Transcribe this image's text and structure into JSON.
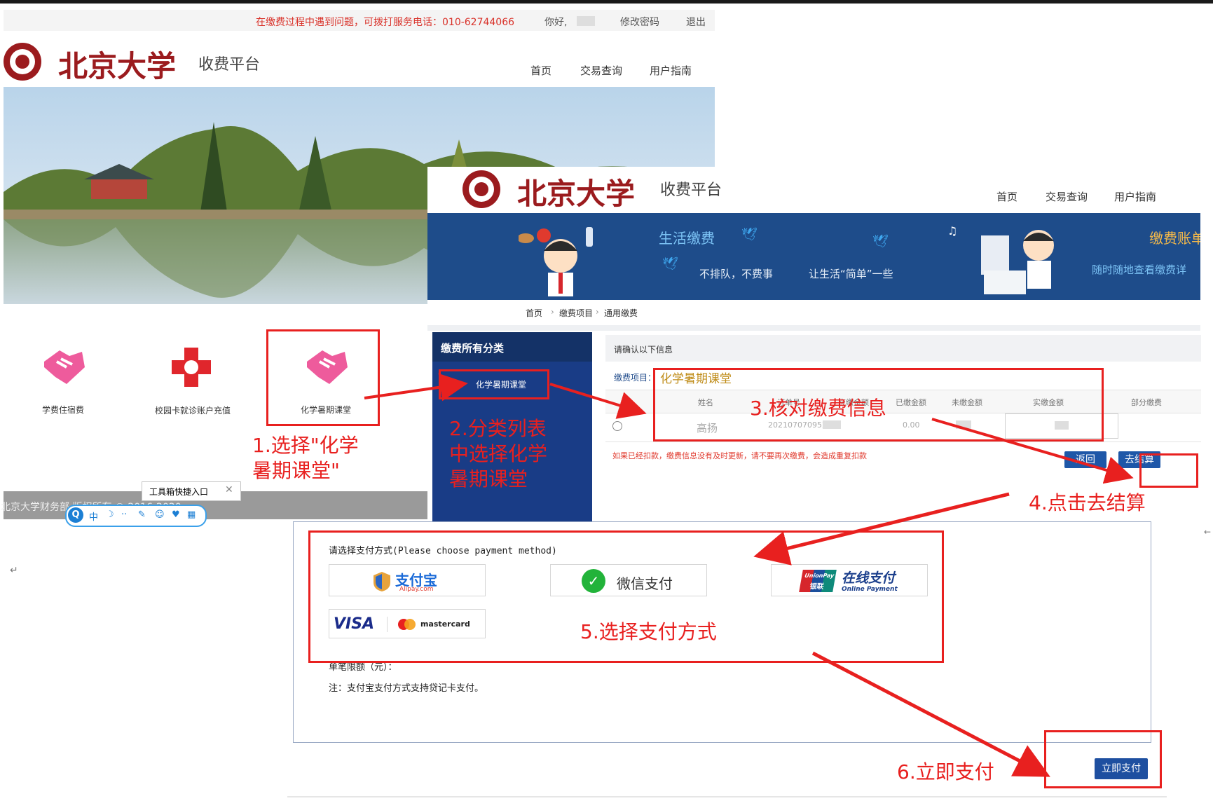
{
  "colors": {
    "pku_red": "#9b1b1e",
    "annotation_red": "#e8201f",
    "navy": "#193c86",
    "pay_blue": "#1e57a8"
  },
  "topbar": {
    "helpline": "在缴费过程中遇到问题，可拨打服务电话：010-62744066",
    "greeting": "你好,",
    "change_password": "修改密码",
    "logout": "退出"
  },
  "header": {
    "university": "北京大学",
    "platform": "收费平台",
    "nav": [
      "首页",
      "交易查询",
      "用户指南"
    ]
  },
  "services": [
    {
      "label": "学费住宿费",
      "icon": "handshake-icon"
    },
    {
      "label": "校园卡就诊账户充值",
      "icon": "medical-cross-icon"
    },
    {
      "label": "化学暑期课堂",
      "icon": "handshake-icon"
    }
  ],
  "footer": {
    "text": "北京大学财务部 版权所有 © 2016-2020"
  },
  "toolbox": {
    "label": "工具箱快捷入口",
    "close": "✕",
    "ime": [
      "中",
      "☽",
      "··",
      "✎",
      "☺",
      "♥",
      "▦"
    ]
  },
  "banner": {
    "title": "生活缴费",
    "tagline_a": "不排队，不费事",
    "tagline_b": "让生活“简单”一些",
    "right_title": "缴费账单",
    "right_sub": "随时随地查看缴费详"
  },
  "breadcrumb": [
    "首页",
    "缴费项目",
    "通用缴费"
  ],
  "categories": {
    "title": "缴费所有分类",
    "items": [
      "化学暑期课堂"
    ]
  },
  "confirm": {
    "title": "请确认以下信息",
    "item_label": "缴费项目：",
    "item_value": "化学暑期课堂",
    "columns": [
      "姓名",
      "订单号",
      "应缴金额",
      "已缴金额",
      "未缴金额",
      "实缴金额",
      "部分缴费"
    ],
    "row": {
      "name": "高扬",
      "order": "202107070952",
      "paid": "0.00"
    },
    "warning": "如果已经扣款，缴费信息没有及时更新，请不要再次缴费，会造成重复扣款",
    "back": "返回",
    "checkout": "去结算"
  },
  "payment": {
    "title": "请选择支付方式(Please choose payment method)",
    "methods": {
      "alipay": "支付宝",
      "alipay_sub": "Alipay.com",
      "wechat": "微信支付",
      "unionpay_badge": "UnionPay",
      "unionpay_badge_cn": "银联",
      "unionpay": "在线支付",
      "unionpay_sub": "Online Payment",
      "visa": "VISA",
      "mastercard": "mastercard"
    },
    "limit": "单笔限额（元）：",
    "note": "注：支付宝支付方式支持贷记卡支付。",
    "pay_now": "立即支付"
  },
  "annotations": {
    "step1": "1.选择\"化学\n暑期课堂\"",
    "step2": "2.分类列表\n中选择化学\n暑期课堂",
    "step3": "3.核对缴费信息",
    "step4": "4.点击去结算",
    "step5": "5.选择支付方式",
    "step6": "6.立即支付"
  },
  "doc_marks": {
    "return_mark": "↵",
    "edge_mark": "←"
  }
}
